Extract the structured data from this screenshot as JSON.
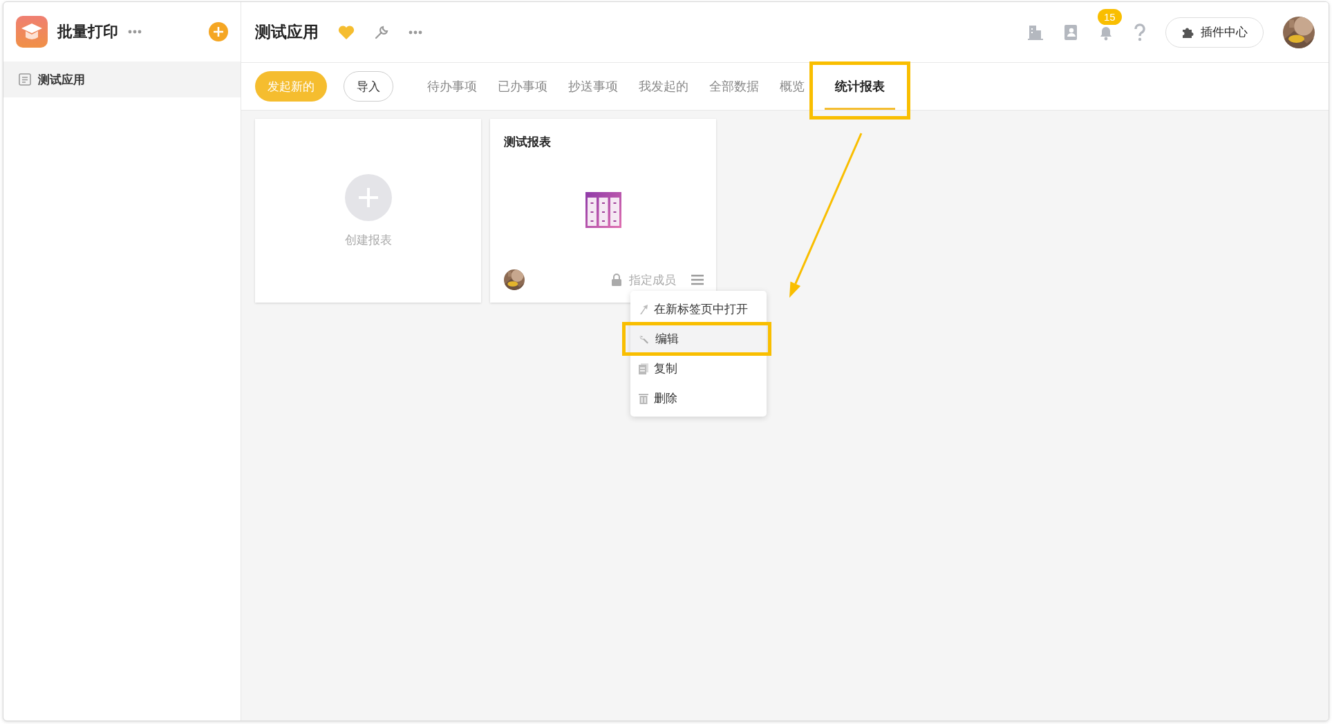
{
  "sidebar": {
    "app_name": "批量打印",
    "items": [
      {
        "label": "测试应用",
        "selected": true
      }
    ]
  },
  "header": {
    "title": "测试应用",
    "favorited": true,
    "notification_count": "15",
    "plugin_button": "插件中心"
  },
  "toolbar": {
    "primary_button": "发起新的",
    "secondary_button": "导入"
  },
  "tabs": [
    {
      "label": "待办事项",
      "selected": false,
      "highlighted": false
    },
    {
      "label": "已办事项",
      "selected": false,
      "highlighted": false
    },
    {
      "label": "抄送事项",
      "selected": false,
      "highlighted": false
    },
    {
      "label": "我发起的",
      "selected": false,
      "highlighted": false
    },
    {
      "label": "全部数据",
      "selected": false,
      "highlighted": false
    },
    {
      "label": "概览",
      "selected": false,
      "highlighted": false
    },
    {
      "label": "统计报表",
      "selected": true,
      "highlighted": true
    }
  ],
  "create_card": {
    "label": "创建报表"
  },
  "reports": [
    {
      "title": "测试报表",
      "permission": "指定成员"
    }
  ],
  "context_menu": {
    "items": [
      {
        "kind": "open",
        "label": "在新标签页中打开",
        "highlighted": false
      },
      {
        "kind": "edit",
        "label": "编辑",
        "highlighted": true
      },
      {
        "kind": "copy",
        "label": "复制",
        "highlighted": false
      },
      {
        "kind": "delete",
        "label": "删除",
        "highlighted": false
      }
    ]
  },
  "callout_arrow": true
}
